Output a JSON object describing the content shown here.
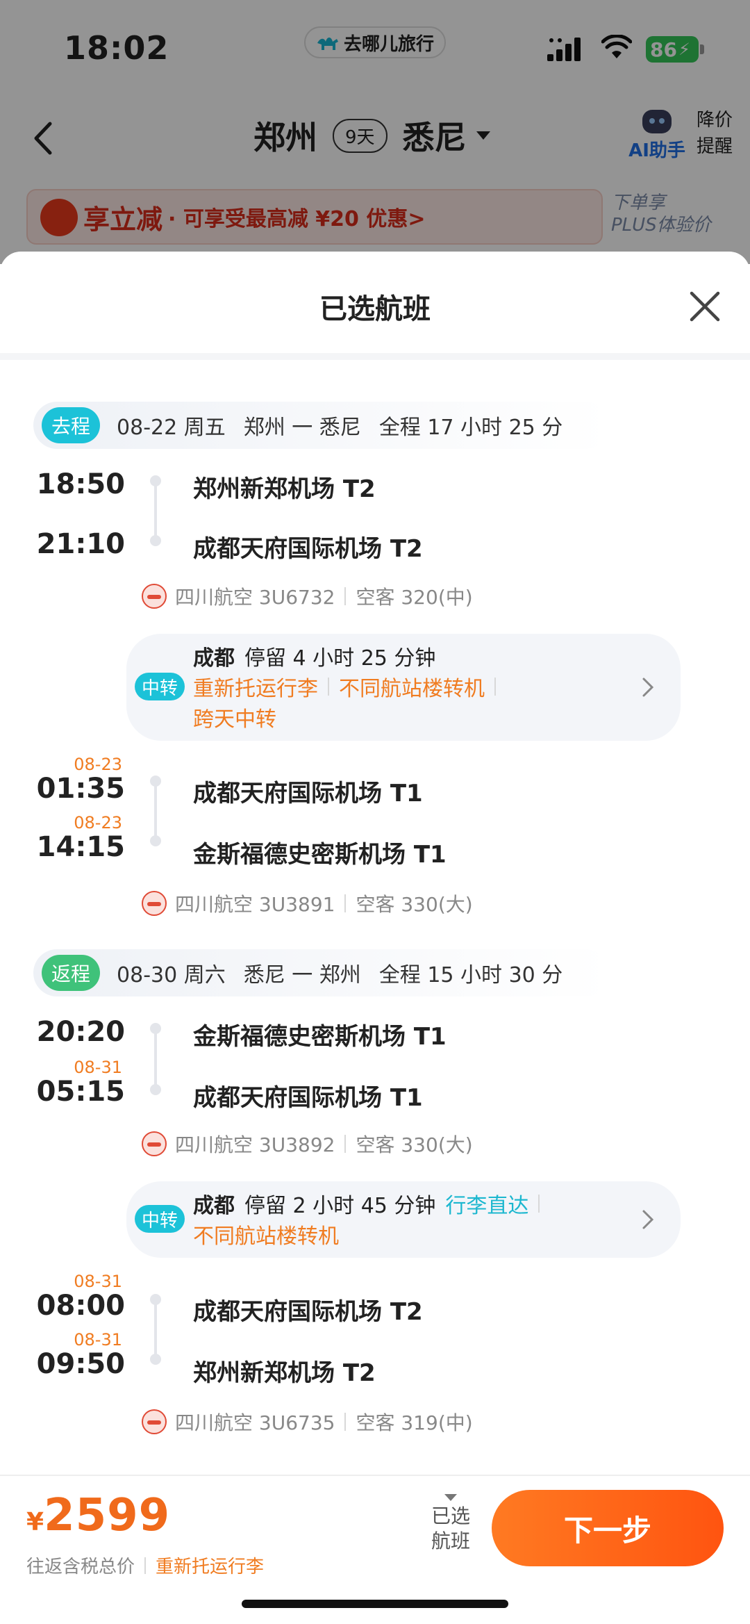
{
  "status": {
    "time": "18:02",
    "battery": "86"
  },
  "brand": {
    "name": "去哪儿旅行"
  },
  "nav": {
    "from": "郑州",
    "days": "9天",
    "to": "悉尼",
    "ai_label": "AI助手",
    "price_alert_line1": "降价",
    "price_alert_line2": "提醒"
  },
  "promo": {
    "main": "享立减",
    "sub": "· 可享受最高减 ¥20 优惠>",
    "plus_line1": "下单享",
    "plus_line2": "PLUS体验价"
  },
  "sheet": {
    "title": "已选航班"
  },
  "outbound": {
    "tag": "去程",
    "date": "08-22 周五",
    "route": "郑州 一 悉尼",
    "total": "全程 17 小时 25 分",
    "leg1": {
      "dep_time": "18:50",
      "dep_airport": "郑州新郑机场 T2",
      "arr_time": "21:10",
      "arr_airport": "成都天府国际机场 T2",
      "airline": "四川航空 3U6732",
      "aircraft": "空客 320(中)"
    },
    "transfer": {
      "tag": "中转",
      "city": "成都",
      "stay": "停留 4 小时 25 分钟",
      "note1": "重新托运行李",
      "note2": "不同航站楼转机",
      "note3": "跨天中转"
    },
    "leg2": {
      "dep_date": "08-23",
      "dep_time": "01:35",
      "dep_airport": "成都天府国际机场 T1",
      "arr_date": "08-23",
      "arr_time": "14:15",
      "arr_airport": "金斯福德史密斯机场 T1",
      "airline": "四川航空 3U3891",
      "aircraft": "空客 330(大)"
    }
  },
  "return": {
    "tag": "返程",
    "date": "08-30 周六",
    "route": "悉尼 一 郑州",
    "total": "全程 15 小时 30 分",
    "leg1": {
      "dep_time": "20:20",
      "dep_airport": "金斯福德史密斯机场 T1",
      "arr_date": "08-31",
      "arr_time": "05:15",
      "arr_airport": "成都天府国际机场 T1",
      "airline": "四川航空 3U3892",
      "aircraft": "空客 330(大)"
    },
    "transfer": {
      "tag": "中转",
      "city": "成都",
      "stay": "停留 2 小时 45 分钟",
      "note1": "行李直达",
      "note2": "不同航站楼转机"
    },
    "leg2": {
      "dep_date": "08-31",
      "dep_time": "08:00",
      "dep_airport": "成都天府国际机场 T2",
      "arr_date": "08-31",
      "arr_time": "09:50",
      "arr_airport": "郑州新郑机场 T2",
      "airline": "四川航空 3U6735",
      "aircraft": "空客 319(中)"
    }
  },
  "bottom": {
    "currency": "¥",
    "price": "2599",
    "note": "往返含税总价",
    "note_warn": "重新托运行李",
    "selected_line1": "已选",
    "selected_line2": "航班",
    "next": "下一步"
  },
  "colors": {
    "accent": "#ff5e14",
    "teal": "#1cc2d8",
    "green": "#3fc27a",
    "warn": "#f07c21"
  }
}
